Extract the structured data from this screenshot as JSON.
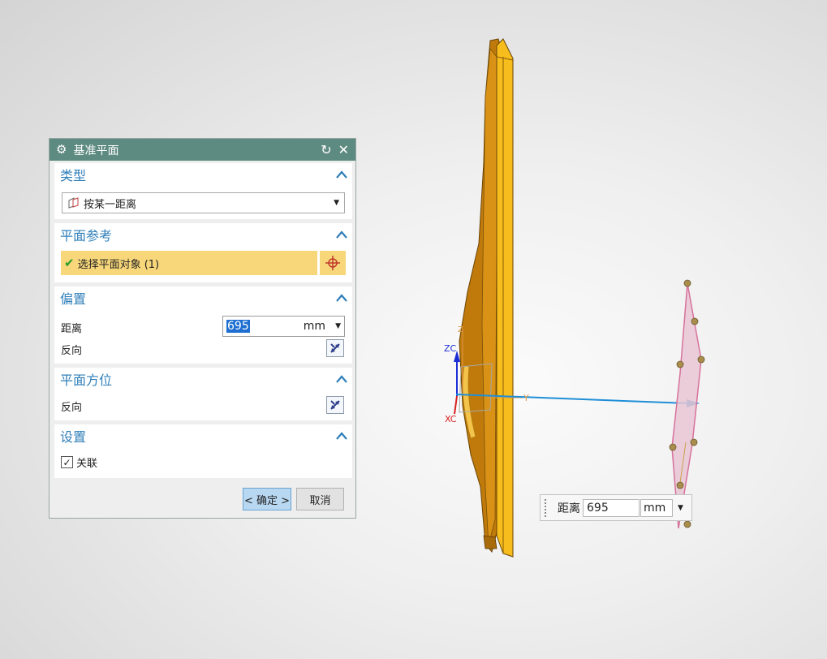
{
  "dialog": {
    "title": "基准平面",
    "type_section": {
      "label": "类型",
      "selected": "按某一距离"
    },
    "ref_section": {
      "label": "平面参考",
      "select_text": "选择平面对象 (1)"
    },
    "offset_section": {
      "label": "偏置",
      "distance_label": "距离",
      "distance_value": "695",
      "unit": "mm",
      "reverse_label": "反向"
    },
    "orient_section": {
      "label": "平面方位",
      "reverse_label": "反向"
    },
    "settings_section": {
      "label": "设置",
      "associative_label": "关联",
      "associative_checked": true
    },
    "ok_label": "< 确定 >",
    "cancel_label": "取消"
  },
  "viewport": {
    "axis_labels": {
      "zc": "ZC",
      "xc": "XC",
      "y": "Y",
      "z": "Z"
    },
    "float_distance": {
      "label": "距离",
      "value": "695",
      "unit": "mm"
    }
  },
  "colors": {
    "accent": "#5e8b81",
    "section_label": "#2f7fb9",
    "selection_bg": "#f7d77a",
    "part_face": "#f6bd1d",
    "part_side": "#c07a0c",
    "plane_fill": "#e8c6d4",
    "plane_edge": "#d7729b",
    "vector": "#1f8fd8"
  }
}
